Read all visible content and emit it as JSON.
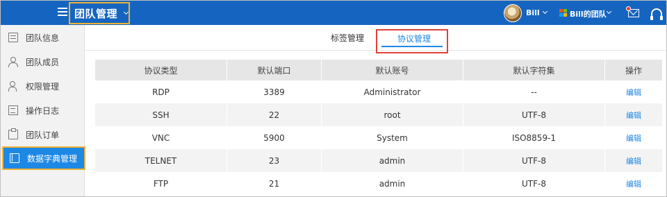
{
  "header": {
    "team_title": "团队管理",
    "user_name": "Bill",
    "team_name": "Bill的团队"
  },
  "sidebar": {
    "items": [
      {
        "label": "团队信息",
        "icon": "document-icon"
      },
      {
        "label": "团队成员",
        "icon": "people-icon"
      },
      {
        "label": "权限管理",
        "icon": "person-key-icon"
      },
      {
        "label": "操作日志",
        "icon": "log-icon"
      },
      {
        "label": "团队订单",
        "icon": "clipboard-icon"
      },
      {
        "label": "数据字典管理",
        "icon": "book-icon",
        "active": true
      }
    ]
  },
  "tabs": {
    "tag_label": "标签管理",
    "protocol_label": "协议管理",
    "active": "协议管理"
  },
  "table": {
    "columns": [
      "协议类型",
      "默认端口",
      "默认账号",
      "默认字符集",
      "操作"
    ],
    "rows": [
      [
        "RDP",
        "3389",
        "Administrator",
        "--",
        "编辑"
      ],
      [
        "SSH",
        "22",
        "root",
        "UTF-8",
        "编辑"
      ],
      [
        "VNC",
        "5900",
        "System",
        "ISO8859-1",
        "编辑"
      ],
      [
        "TELNET",
        "23",
        "admin",
        "UTF-8",
        "编辑"
      ],
      [
        "FTP",
        "21",
        "admin",
        "UTF-8",
        "编辑"
      ]
    ]
  },
  "colors": {
    "topbar": "#1565c0",
    "accent": "#1e88e5",
    "highlight_orange": "#f2b233",
    "highlight_red": "#e0403c"
  }
}
